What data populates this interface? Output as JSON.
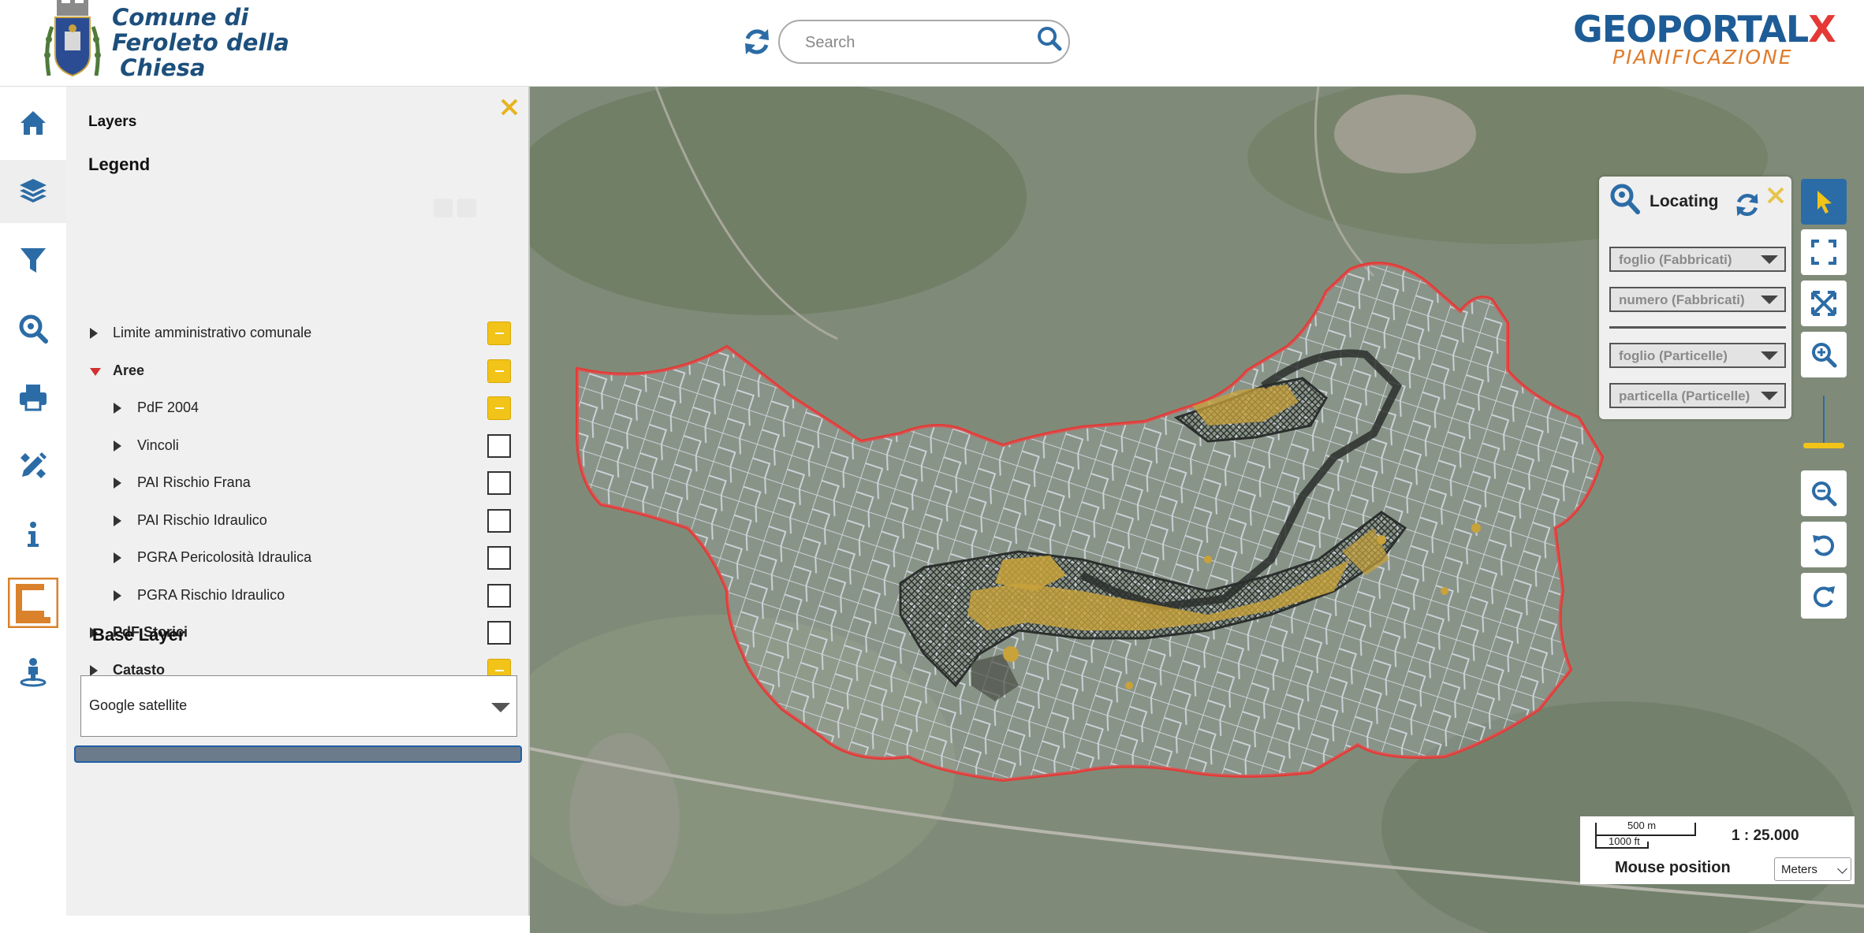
{
  "header": {
    "title_lines": [
      "Comune di",
      "Feroleto della",
      " Chiesa"
    ],
    "search_placeholder": "Search",
    "brand_top": "GEOPORTAL",
    "brand_x": "X",
    "brand_sub": "PIANIFICAZIONE"
  },
  "sidebar_icons": [
    "home-icon",
    "layers-icon",
    "filter-icon",
    "search-zoom-icon",
    "print-icon",
    "draw-tools-icon",
    "info-icon",
    "nemea-logo",
    "location-person-icon"
  ],
  "panel": {
    "tab_layers": "Layers",
    "tab_legend": "Legend",
    "layers": [
      {
        "label": "Limite amministrativo comunale",
        "state": "partial",
        "expanded": false,
        "bold": false
      },
      {
        "label": "Aree",
        "state": "partial",
        "expanded": true,
        "bold": true
      },
      {
        "label": "PdF 2004",
        "state": "partial",
        "expanded": false,
        "bold": false
      },
      {
        "label": "Vincoli",
        "state": "empty",
        "expanded": false,
        "bold": false
      },
      {
        "label": "PAI Rischio Frana",
        "state": "empty",
        "expanded": false,
        "bold": false
      },
      {
        "label": "PAI Rischio Idraulico",
        "state": "empty",
        "expanded": false,
        "bold": false
      },
      {
        "label": "PGRA Pericolosità Idraulica",
        "state": "empty",
        "expanded": false,
        "bold": false
      },
      {
        "label": "PGRA Rischio Idraulico",
        "state": "empty",
        "expanded": false,
        "bold": false
      },
      {
        "label": "PdF Storici",
        "state": "empty",
        "expanded": false,
        "bold": true
      },
      {
        "label": "Catasto",
        "state": "partial",
        "expanded": false,
        "bold": true
      }
    ],
    "base_layer_title": "Base Layer",
    "base_layer_value": "Google satellite"
  },
  "locating": {
    "title": "Locating",
    "selects": [
      "foglio (Fabbricati)",
      "numero (Fabbricati)",
      "foglio (Particelle)",
      "particella (Particelle)"
    ]
  },
  "toolbar": [
    "select-pointer-icon",
    "fullscreen-icon",
    "zoom-extent-icon",
    "zoom-in-icon",
    "zoom-out-icon",
    "undo-icon",
    "redo-icon"
  ],
  "scale": {
    "metric": "500 m",
    "imperial": "1000 ft",
    "ratio": "1 : 25.000",
    "mouse_position": "Mouse position",
    "units": "Meters"
  },
  "colors": {
    "primary": "#2c6ca6",
    "municipal_title": "#1d4f7c",
    "partial_check": "#f2c318",
    "boundary": "#e53935",
    "brand_orange": "#e07b2a"
  }
}
